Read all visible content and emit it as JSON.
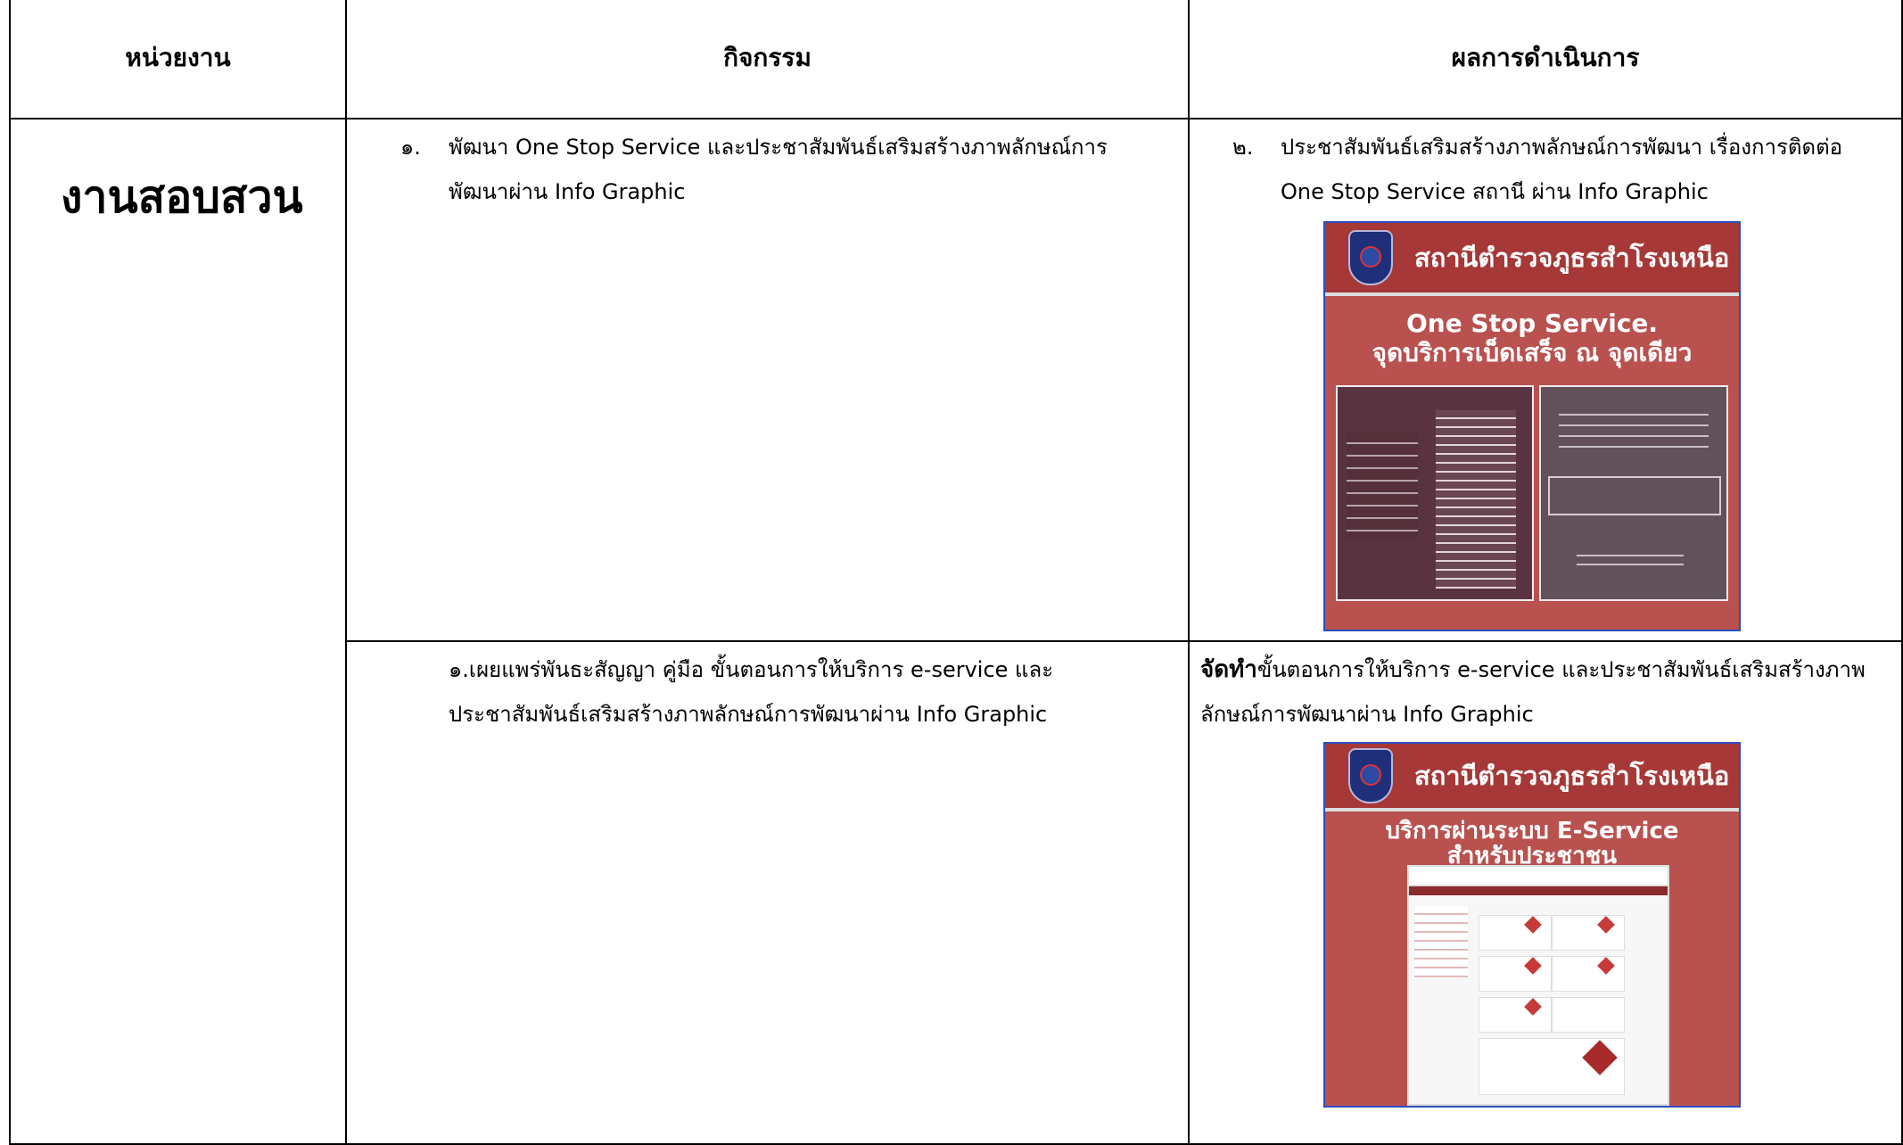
{
  "table": {
    "headers": [
      "หน่วยงาน",
      "กิจกรรม",
      "ผลการดำเนินการ"
    ],
    "unit": "งานสอบสวน",
    "row1": {
      "activity_no": "๑.",
      "activity": "พัฒนา One Stop Service และประชาสัมพันธ์เสริมสร้างภาพลักษณ์การพัฒนาผ่าน Info Graphic",
      "result_no": "๒.",
      "result": "ประชาสัมพันธ์เสริมสร้างภาพลักษณ์การพัฒนา เรื่องการติดต่อ One Stop Service สถานี ผ่าน Info Graphic"
    },
    "row2": {
      "activity": "๑.เผยแพร่พันธะสัญญา คู่มือ ขั้นตอนการให้บริการ e-service และประชาสัมพันธ์เสริมสร้างภาพลักษณ์การพัฒนาผ่าน Info Graphic",
      "result_bold": "จัดทำ",
      "result_rest": "ขั้นตอนการให้บริการ e-service และประชาสัมพันธ์เสริมสร้างภาพลักษณ์การพัฒนาผ่าน Info Graphic"
    }
  },
  "poster1": {
    "station": "สถานีตำรวจภูธรสำโรงเหนือ",
    "subtitle_line1": "One Stop Service.",
    "subtitle_line2": "จุดบริการเบ็ดเสร็จ ณ จุดเดียว"
  },
  "poster2": {
    "station": "สถานีตำรวจภูธรสำโรงเหนือ",
    "subtitle_line1": "บริการผ่านระบบ E-Service",
    "subtitle_line2": "สำหรับประชาชน"
  }
}
